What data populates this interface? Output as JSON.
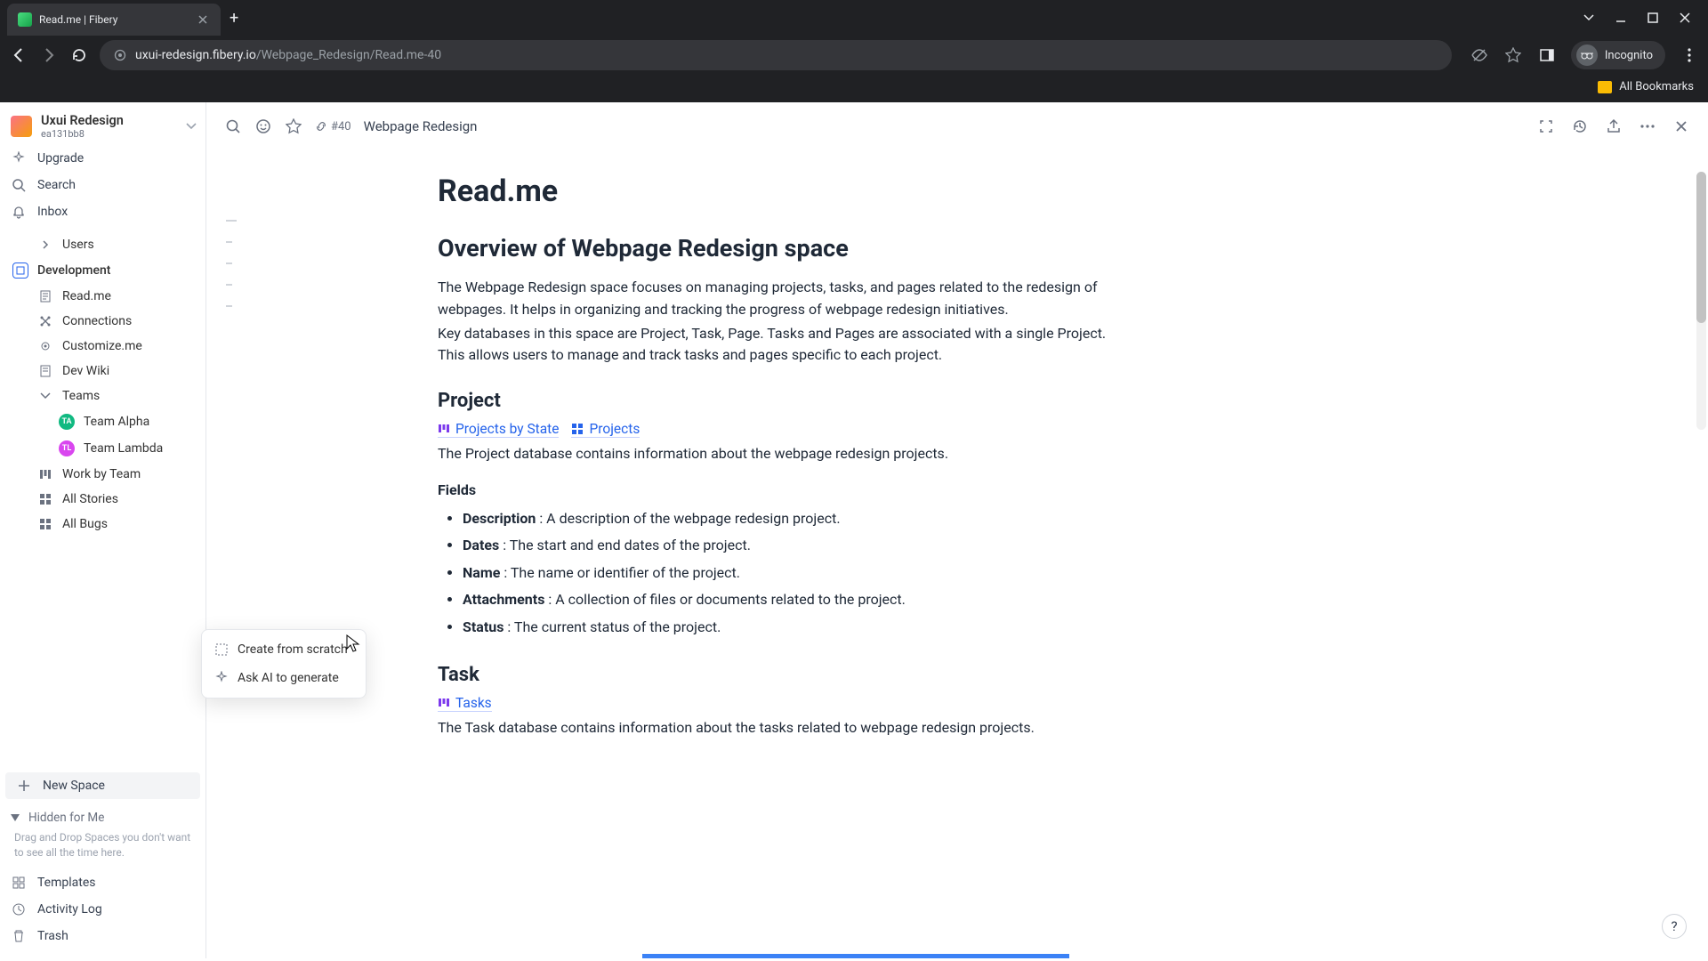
{
  "browser": {
    "tab_title": "Read.me | Fibery",
    "url_domain": "uxui-redesign.fibery.io",
    "url_path": "/Webpage_Redesign/Read.me-40",
    "incognito_label": "Incognito",
    "bookmarks_label": "All Bookmarks"
  },
  "sidebar": {
    "workspace_name": "Uxui Redesign",
    "workspace_sub": "ea131bb8",
    "upgrade": "Upgrade",
    "search": "Search",
    "inbox": "Inbox",
    "users": "Users",
    "dev_space": "Development",
    "items": {
      "readme": "Read.me",
      "connections": "Connections",
      "customize": "Customize.me",
      "devwiki": "Dev Wiki",
      "teams": "Teams",
      "team_alpha": "Team Alpha",
      "team_lambda": "Team Lambda",
      "work_by_team": "Work by Team",
      "all_stories": "All Stories",
      "all_bugs": "All Bugs"
    },
    "new_space": "New Space",
    "hidden_label": "Hidden for Me",
    "hidden_note": "Drag and Drop Spaces you don't want to see all the time here.",
    "templates": "Templates",
    "activity_log": "Activity Log",
    "trash": "Trash"
  },
  "popup": {
    "create_scratch": "Create from scratch",
    "ask_ai": "Ask AI to generate"
  },
  "doc_header": {
    "id": "#40",
    "breadcrumb": "Webpage Redesign"
  },
  "doc": {
    "title": "Read.me",
    "h2_overview": "Overview of Webpage Redesign space",
    "p_overview1": "The Webpage Redesign space focuses on managing projects, tasks, and pages related to the redesign of webpages. It helps in organizing and tracking the progress of webpage redesign initiatives.",
    "p_overview2": "Key databases in this space are Project, Task, Page. Tasks and Pages are associated with a single Project. This allows users to manage and track tasks and pages specific to each project.",
    "h3_project": "Project",
    "link_projects_by_state": "Projects by State",
    "link_projects": "Projects",
    "p_project": "The Project database contains information about the webpage redesign projects.",
    "fields_label": "Fields",
    "fields": [
      {
        "name": "Description",
        "desc": " : A description of the webpage redesign project."
      },
      {
        "name": "Dates",
        "desc": " : The start and end dates of the project."
      },
      {
        "name": "Name",
        "desc": " : The name or identifier of the project."
      },
      {
        "name": "Attachments",
        "desc": " : A collection of files or documents related to the project."
      },
      {
        "name": "Status",
        "desc": " : The current status of the project."
      }
    ],
    "h3_task": "Task",
    "link_tasks": "Tasks",
    "p_task": "The Task database contains information about the tasks related to webpage redesign projects."
  },
  "help_label": "?"
}
